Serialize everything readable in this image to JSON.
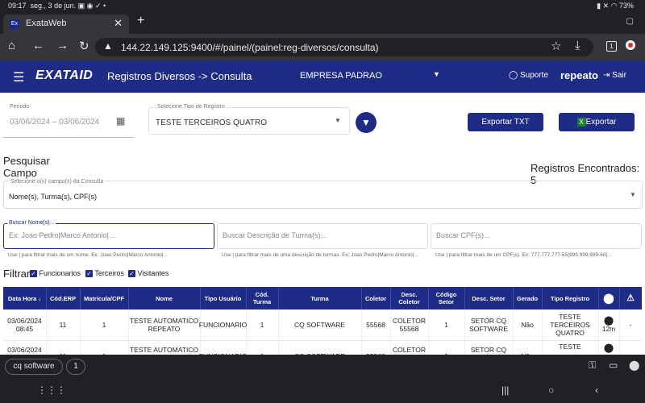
{
  "status": {
    "time": "09:17",
    "date": "seg., 3 de jun.",
    "battery": "73%"
  },
  "browser": {
    "tab_favicon": "Ex",
    "tab_title": "ExataWeb",
    "close": "✕",
    "new_tab": "+",
    "url": "144.22.149.125:9400/#/painel/(painel:reg-diversos/consulta)",
    "tab_count": "1"
  },
  "header": {
    "logo": "EXATAID",
    "title": "Registros Diversos -> Consulta",
    "company": "EMPRESA PADRAO",
    "support": "Suporte",
    "user": "repeato",
    "exit": "Sair"
  },
  "filters": {
    "period_label": "Periodo",
    "period_value": "03/06/2024 – 03/06/2024",
    "type_label": "Selecione Tipo de Registro",
    "type_value": "TESTE TERCEIROS QUATRO",
    "export_txt": "Exportar TXT",
    "export": "Exportar"
  },
  "search": {
    "title": "Pesquisar Campo",
    "found": "Registros Encontrados: 5",
    "campos_label": "Selecione o(s) campo(s) da Consulta",
    "campos_value": "Nome(s), Turma(s), CPF(s)",
    "name_label": "Buscar Nome(s)...",
    "name_placeholder": "Ex: Joao Pedro|Marco Antonio|...",
    "name_hint": "Use | para filtrar mais de um nome. Ex: Joao Pedro|Marco Antonio|...",
    "turma_placeholder": "Buscar Descrição de Turma(s)...",
    "turma_hint": "Use | para filtrar mais de uma descrição de turmas. Ex: Joao Pedro|Marco Antonio|...",
    "cpf_placeholder": "Buscar CPF(s)...",
    "cpf_hint": "Use | para filtrar mais de um CPF(s). Ex: 777.777.777-55|999.999.999-60|...",
    "filter_label": "Filtrar",
    "check_func": "Funcionarios",
    "check_terc": "Terceiros",
    "check_visit": "Visitantes"
  },
  "table": {
    "headers": [
      "Data Hora",
      "Cód.ERP",
      "Matricula/CPF",
      "Nome",
      "Tipo Usuário",
      "Cód. Turma",
      "Turma",
      "Coletor",
      "Desc. Coletor",
      "Código Setor",
      "Desc. Setor",
      "Gerado",
      "Tipo Registro"
    ],
    "rows": [
      [
        "03/06/2024 08:45",
        "11",
        "1",
        "TESTE AUTOMATICO REPEATO",
        "FUNCIONARIO",
        "1",
        "CQ SOFTWARE",
        "55568",
        "COLETOR 55568",
        "1",
        "SETOR CQ SOFTWARE",
        "Não",
        "TESTE TERCEIROS QUATRO",
        "12m",
        "-"
      ],
      [
        "03/06/2024",
        "11",
        "1",
        "TESTE AUTOMATICO",
        "FUNCIONARIO",
        "1",
        "CQ SOFTWARE",
        "55568",
        "COLETOR",
        "1",
        "SETOR CQ",
        "Não",
        "TESTE",
        "",
        ""
      ]
    ]
  },
  "bottom": {
    "chip_label": "cq software",
    "chip_count": "1"
  }
}
